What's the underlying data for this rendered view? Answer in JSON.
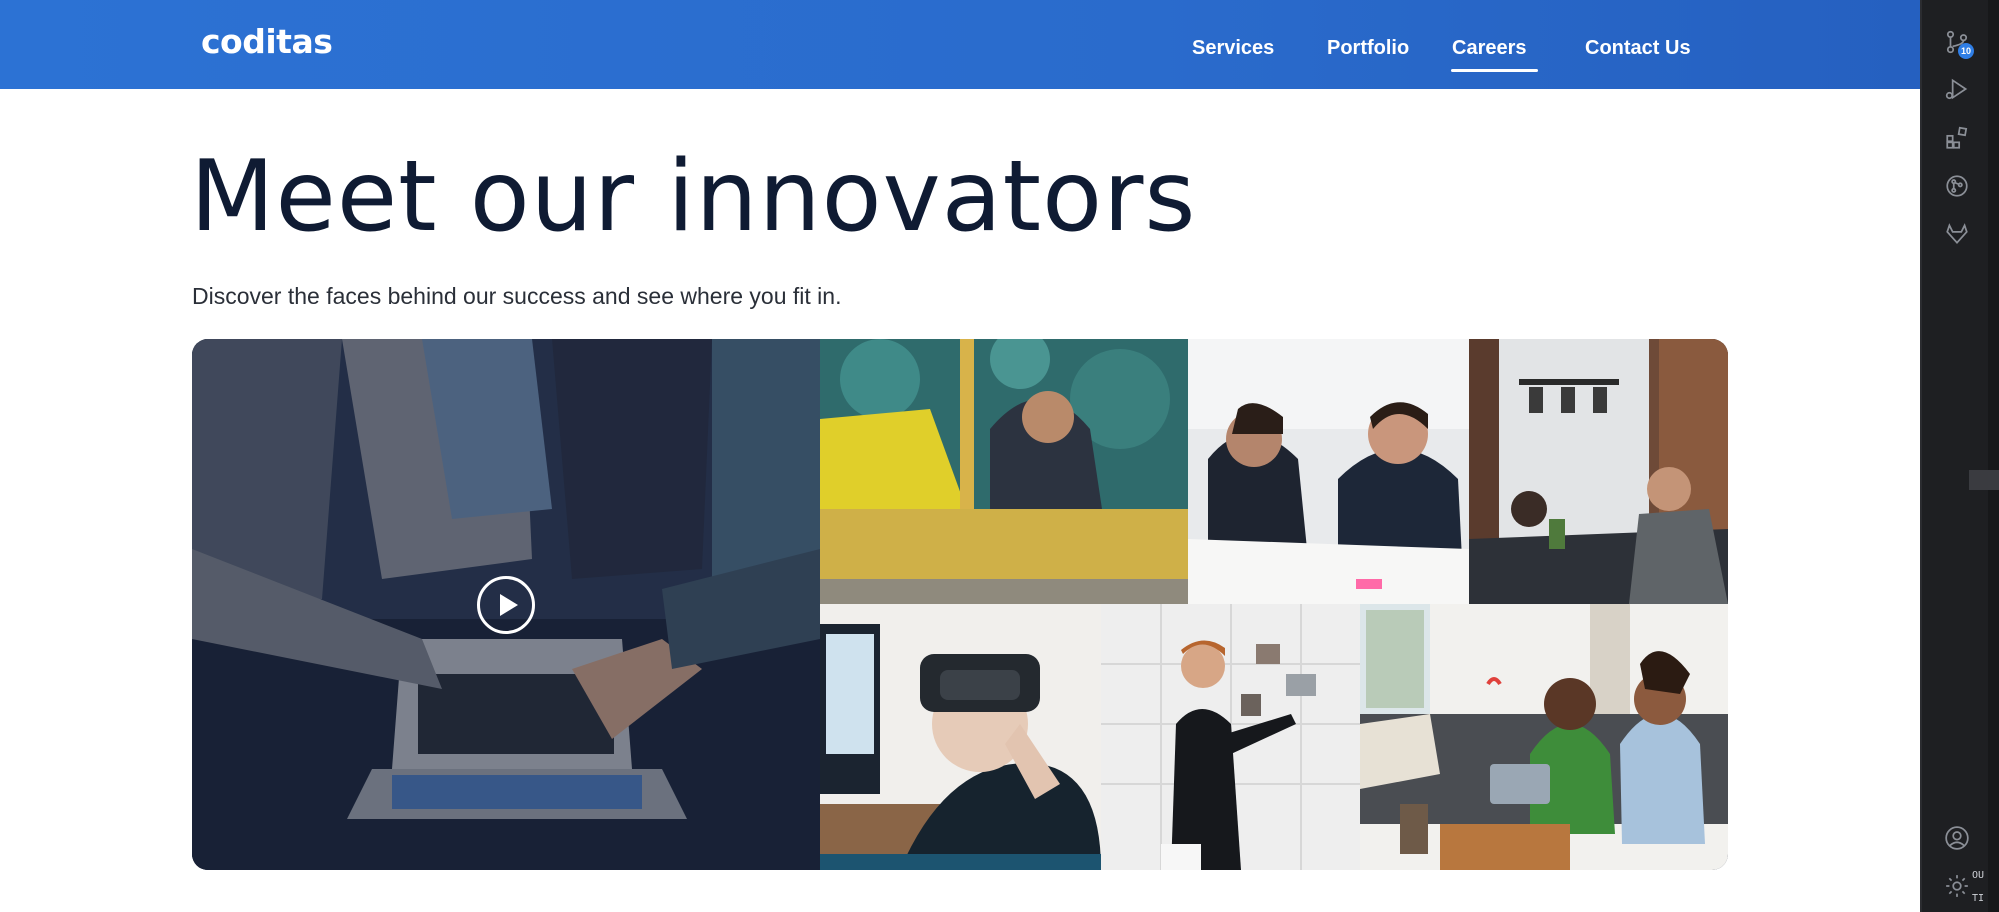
{
  "site": {
    "logo": "coditas",
    "nav": [
      {
        "label": "Services",
        "active": false
      },
      {
        "label": "Portfolio",
        "active": false
      },
      {
        "label": "Careers",
        "active": true
      },
      {
        "label": "Contact Us",
        "active": false
      }
    ],
    "hero": {
      "title": "Meet our innovators",
      "subtitle": "Discover the faces behind our success and see where you fit in."
    },
    "gallery": {
      "tiles": [
        "team-laptop-video",
        "office-lounge",
        "meeting-conversation",
        "open-office",
        "vr-headset",
        "wall-planning",
        "sofa-chat"
      ]
    },
    "colors": {
      "header": "#2c72d4",
      "title": "#0f1b33",
      "badge": "#2f7ee6"
    }
  },
  "activity_bar": {
    "source_control_badge": "10",
    "items": [
      "source-control-icon",
      "run-debug-icon",
      "extensions-icon",
      "git-graph-icon",
      "gitlab-icon",
      "account-icon",
      "settings-gear-icon"
    ],
    "mini_labels": [
      "OU",
      "TI"
    ]
  }
}
